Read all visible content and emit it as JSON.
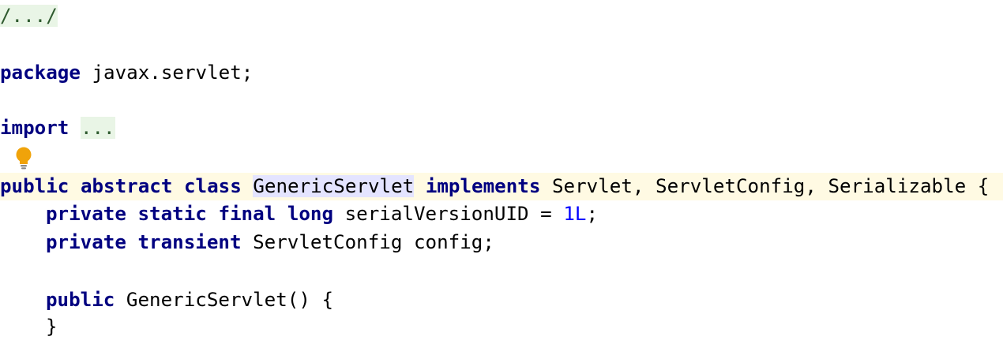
{
  "editor": {
    "file_header_fold": "/.../",
    "package_line": {
      "keyword": "package",
      "name": " javax.servlet;"
    },
    "import_line": {
      "keyword": "import",
      "fold": "..."
    },
    "class_decl": {
      "kw1": "public",
      "kw2": "abstract",
      "kw3": "class",
      "class_name": "GenericServlet",
      "kw4": "implements",
      "interfaces": " Servlet, ServletConfig, Serializable {"
    },
    "field1": {
      "kw1": "private",
      "kw2": "static",
      "kw3": "final",
      "kw4": "long",
      "text": " serialVersionUID = ",
      "value": "1L",
      "end": ";"
    },
    "field2": {
      "kw1": "private",
      "kw2": "transient",
      "text": " ServletConfig config;"
    },
    "constructor": {
      "keyword": "public",
      "signature": " GenericServlet() {"
    },
    "closing_brace": "}",
    "intention_icon": "lightbulb-icon"
  },
  "colors": {
    "keyword": "#000080",
    "number": "#0000ff",
    "current_line": "#fffae3",
    "identifier_highlight": "#e4e4ff",
    "fold_background": "#e9f5e6",
    "bulb": "#f0a30a"
  }
}
